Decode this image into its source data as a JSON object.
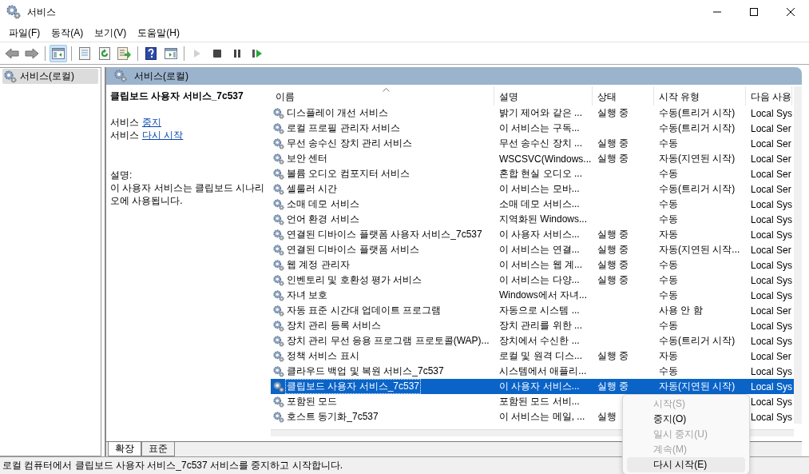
{
  "window": {
    "title": "서비스"
  },
  "menu_bar": [
    "파일(F)",
    "동작(A)",
    "보기(V)",
    "도움말(H)"
  ],
  "toolbar": [
    {
      "kind": "back",
      "pressed": false,
      "disabled": false
    },
    {
      "kind": "forward",
      "pressed": false,
      "disabled": false
    },
    {
      "kind": "sep"
    },
    {
      "kind": "pane",
      "pressed": true,
      "disabled": false
    },
    {
      "kind": "sep"
    },
    {
      "kind": "properties",
      "pressed": false,
      "disabled": false
    },
    {
      "kind": "refresh",
      "pressed": false,
      "disabled": false
    },
    {
      "kind": "export",
      "pressed": false,
      "disabled": false
    },
    {
      "kind": "sep"
    },
    {
      "kind": "help",
      "pressed": false,
      "disabled": false
    },
    {
      "kind": "view",
      "pressed": false,
      "disabled": false
    },
    {
      "kind": "sep"
    },
    {
      "kind": "play",
      "pressed": false,
      "disabled": true
    },
    {
      "kind": "stop",
      "pressed": false,
      "disabled": false
    },
    {
      "kind": "pause",
      "pressed": false,
      "disabled": false
    },
    {
      "kind": "resume",
      "pressed": false,
      "disabled": false
    }
  ],
  "tree": {
    "items": [
      {
        "label": "서비스(로컬)",
        "selected": true
      }
    ]
  },
  "panel": {
    "title": "서비스(로컬)",
    "detail": {
      "service_name": "클립보드 사용자 서비스_7c537",
      "actions": [
        {
          "prefix": "서비스",
          "link": "중지"
        },
        {
          "prefix": "서비스",
          "link": "다시 시작"
        }
      ],
      "description_label": "설명:",
      "description": "이 사용자 서비스는 클립보드 시나리오에 사용됩니다."
    },
    "table": {
      "columns": [
        {
          "label": "이름",
          "sorted": true
        },
        {
          "label": "설명",
          "sorted": false
        },
        {
          "label": "상태",
          "sorted": false
        },
        {
          "label": "시작 유형",
          "sorted": false
        },
        {
          "label": "다음 사용",
          "sorted": false
        }
      ],
      "rows": [
        {
          "cells": [
            "디스플레이 개선 서비스",
            "밝기 제어와 같은 ...",
            "실행 중",
            "수동(트리거 시작)",
            "Local Sys"
          ],
          "selected": false
        },
        {
          "cells": [
            "로컬 프로필 관리자 서비스",
            "이 서비스는 구독...",
            "",
            "수동(트리거 시작)",
            "Local Ser"
          ],
          "selected": false
        },
        {
          "cells": [
            "무선 송수신 장치 관리 서비스",
            "무선 송수신 장치 ...",
            "실행 중",
            "수동",
            "Local Ser"
          ],
          "selected": false
        },
        {
          "cells": [
            "보안 센터",
            "WSCSVC(Windows...",
            "실행 중",
            "자동(지연된 시작)",
            "Local Ser"
          ],
          "selected": false
        },
        {
          "cells": [
            "볼륨 오디오 컴포지터 서비스",
            "혼합 현실 오디오 ...",
            "",
            "수동",
            "Local Ser"
          ],
          "selected": false
        },
        {
          "cells": [
            "셀룰러 시간",
            "이 서비스는 모바...",
            "",
            "수동(트리거 시작)",
            "Local Ser"
          ],
          "selected": false
        },
        {
          "cells": [
            "소매 데모 서비스",
            "소매 데모 서비스...",
            "",
            "수동",
            "Local Sys"
          ],
          "selected": false
        },
        {
          "cells": [
            "언어 환경 서비스",
            "지역화된 Windows...",
            "",
            "수동",
            "Local Sys"
          ],
          "selected": false
        },
        {
          "cells": [
            "연결된 디바이스 플랫폼 사용자 서비스_7c537",
            "이 사용자 서비스...",
            "실행 중",
            "자동",
            "Local Sys"
          ],
          "selected": false
        },
        {
          "cells": [
            "연결된 디바이스 플랫폼 서비스",
            "이 서비스는 연결...",
            "실행 중",
            "자동(지연된 시작...",
            "Local Ser"
          ],
          "selected": false
        },
        {
          "cells": [
            "웹 계정 관리자",
            "이 서비스는 웹 계...",
            "실행 중",
            "수동",
            "Local Sys"
          ],
          "selected": false
        },
        {
          "cells": [
            "인벤토리 및 호환성 평가 서비스",
            "이 서비스는 다양...",
            "실행 중",
            "수동",
            "Local Sys"
          ],
          "selected": false
        },
        {
          "cells": [
            "자녀 보호",
            "Windows에서 자녀...",
            "",
            "수동",
            "Local Sys"
          ],
          "selected": false
        },
        {
          "cells": [
            "자동 표준 시간대 업데이트 프로그램",
            "자동으로 시스템 ...",
            "",
            "사용 안 함",
            "Local Ser"
          ],
          "selected": false
        },
        {
          "cells": [
            "장치 관리 등록 서비스",
            "장치 관리를 위한 ...",
            "",
            "수동",
            "Local Sys"
          ],
          "selected": false
        },
        {
          "cells": [
            "장치 관리 무선 응용 프로그램 프로토콜(WAP)...",
            "장치에서 수신한 ...",
            "",
            "수동(트리거 시작)",
            "Local Sys"
          ],
          "selected": false
        },
        {
          "cells": [
            "정책 서비스 표시",
            "로컬 및 원격 디스...",
            "실행 중",
            "자동",
            "Local Ser"
          ],
          "selected": false
        },
        {
          "cells": [
            "클라우드 백업 및 복원 서비스_7c537",
            "시스템에서 애플리...",
            "",
            "수동",
            "Local Sys"
          ],
          "selected": false
        },
        {
          "cells": [
            "클립보드 사용자 서비스_7c537",
            "이 사용자 서비스...",
            "실행 중",
            "자동(지연된 시작)",
            "Local Sys"
          ],
          "selected": true
        },
        {
          "cells": [
            "포함된 모드",
            "포함된 모드 서비...",
            "",
            "",
            "Local Sys"
          ],
          "selected": false
        },
        {
          "cells": [
            "호스트 동기화_7c537",
            "이 서비스는 메일, ...",
            "실행",
            "",
            "Local Sys"
          ],
          "selected": false
        }
      ]
    },
    "tabs": [
      {
        "label": "확장",
        "selected": true
      },
      {
        "label": "표준",
        "selected": false
      }
    ]
  },
  "status_bar": "로컬 컴퓨터에서 클립보드 사용자 서비스_7c537 서비스를 중지하고 시작합니다.",
  "context_menu": [
    {
      "label": "시작(S)",
      "disabled": true,
      "hovered": false
    },
    {
      "label": "중지(O)",
      "disabled": false,
      "hovered": false
    },
    {
      "label": "일시 중지(U)",
      "disabled": true,
      "hovered": false
    },
    {
      "label": "계속(M)",
      "disabled": true,
      "hovered": false
    },
    {
      "label": "다시 시작(E)",
      "disabled": false,
      "hovered": true
    }
  ]
}
